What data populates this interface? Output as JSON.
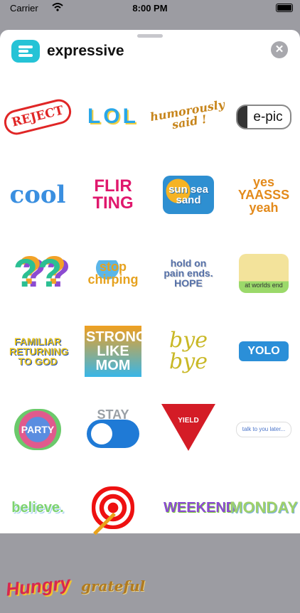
{
  "status": {
    "carrier": "Carrier",
    "time": "8:00 PM"
  },
  "header": {
    "title": "expressive"
  },
  "stickers": [
    {
      "text": "REJECT"
    },
    {
      "text": "LOL"
    },
    {
      "text": "humorously said !"
    },
    {
      "text": "e-pic"
    },
    {
      "text": "cool"
    },
    {
      "text": "FLIR TING"
    },
    {
      "text": "sun sea sand"
    },
    {
      "text": "yes YAASSS yeah"
    },
    {
      "text": "??"
    },
    {
      "text": "stop chirping"
    },
    {
      "text": "hold on pain ends. HOPE"
    },
    {
      "text": "at worlds end"
    },
    {
      "text": "FAMILIAR RETURNING TO GOD"
    },
    {
      "text": "STRONG LIKE MOM"
    },
    {
      "text": "bye bye"
    },
    {
      "text": "YOLO"
    },
    {
      "text": "PARTY"
    },
    {
      "text": "STAY"
    },
    {
      "text": "YIELD"
    },
    {
      "text": "talk to you later..."
    },
    {
      "text": "believe."
    },
    {
      "text": ""
    },
    {
      "text": "WEEKEND"
    },
    {
      "text": "MONDAY"
    },
    {
      "text": "Hungry"
    },
    {
      "text": "grateful"
    }
  ]
}
